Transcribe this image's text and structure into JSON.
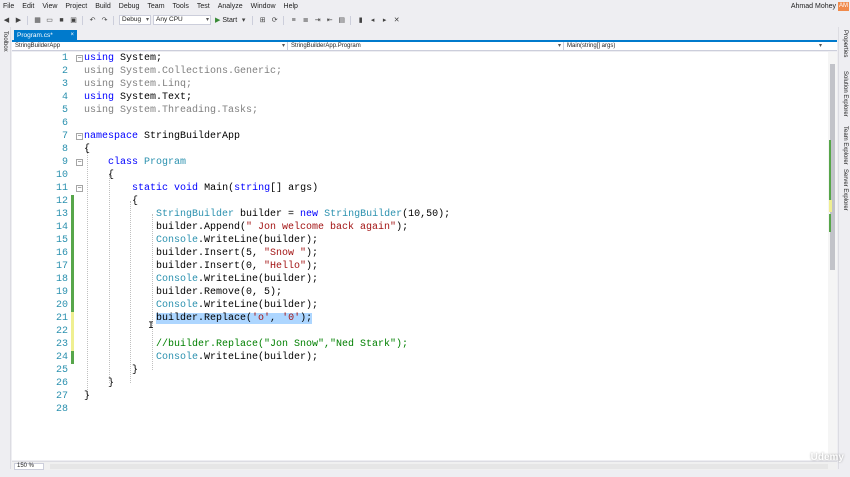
{
  "menu": [
    "File",
    "Edit",
    "View",
    "Project",
    "Build",
    "Debug",
    "Team",
    "Tools",
    "Test",
    "Analyze",
    "Window",
    "Help"
  ],
  "user": {
    "name": "Ahmad Mohey",
    "initials": "AM"
  },
  "toolbar": {
    "config": "Debug",
    "platform": "Any CPU",
    "start": "Start"
  },
  "side_tabs": {
    "left": [
      "Toolbox"
    ],
    "right": [
      "Properties",
      "Solution Explorer",
      "Team Explorer",
      "Server Explorer"
    ]
  },
  "tab": {
    "label": "Program.cs*",
    "close": "×"
  },
  "nav": {
    "project": "StringBuilderApp",
    "class": "StringBuilderApp.Program",
    "member": "Main(string[] args)"
  },
  "zoom": "150 %",
  "watermark": "Udemy",
  "editor": {
    "lines": [
      {
        "n": "1",
        "t": "using System;"
      },
      {
        "n": "2",
        "t": "using System.Collections.Generic;"
      },
      {
        "n": "3",
        "t": "using System.Linq;"
      },
      {
        "n": "4",
        "t": "using System.Text;"
      },
      {
        "n": "5",
        "t": "using System.Threading.Tasks;"
      },
      {
        "n": "6",
        "t": ""
      },
      {
        "n": "7",
        "t": "namespace StringBuilderApp"
      },
      {
        "n": "8",
        "t": "{"
      },
      {
        "n": "9",
        "t": "class Program"
      },
      {
        "n": "10",
        "t": "{"
      },
      {
        "n": "11",
        "t": "static void Main(string[] args)"
      },
      {
        "n": "12",
        "t": "{"
      },
      {
        "n": "13",
        "t": "StringBuilder builder = new StringBuilder(10,50);"
      },
      {
        "n": "14",
        "t": "builder.Append(\" Jon welcome back again\");"
      },
      {
        "n": "15",
        "t": "Console.WriteLine(builder);"
      },
      {
        "n": "16",
        "t": "builder.Insert(5, \"Snow \");"
      },
      {
        "n": "17",
        "t": "builder.Insert(0, \"Hello\");"
      },
      {
        "n": "18",
        "t": "Console.WriteLine(builder);"
      },
      {
        "n": "19",
        "t": "builder.Remove(0, 5);"
      },
      {
        "n": "20",
        "t": "Console.WriteLine(builder);"
      },
      {
        "n": "21",
        "t": "builder.Replace('o', '0');"
      },
      {
        "n": "22",
        "t": ""
      },
      {
        "n": "23",
        "t": "//builder.Replace(\"Jon Snow\",\"Ned Stark\");"
      },
      {
        "n": "24",
        "t": "Console.WriteLine(builder);"
      },
      {
        "n": "25",
        "t": "}"
      },
      {
        "n": "26",
        "t": "}"
      },
      {
        "n": "27",
        "t": "}"
      },
      {
        "n": "28",
        "t": ""
      }
    ]
  }
}
